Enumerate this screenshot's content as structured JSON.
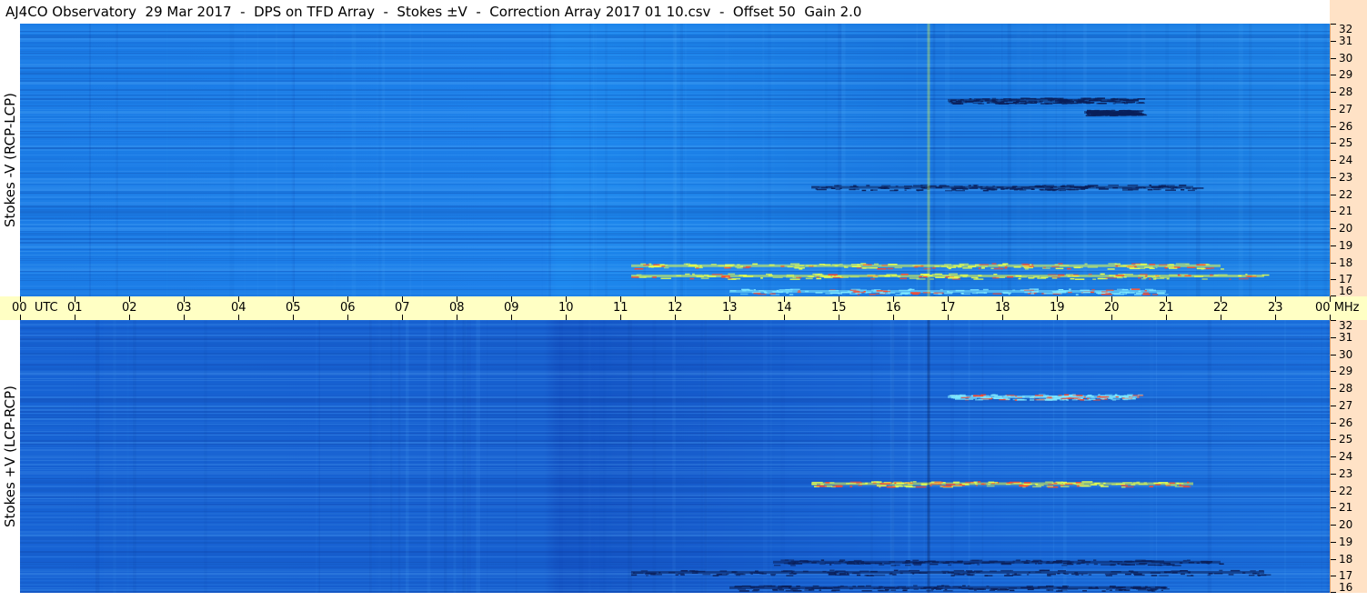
{
  "header": {
    "title": "AJ4CO Observatory  29 Mar 2017  -  DPS on TFD Array  -  Stokes ±V  -  Correction Array 2017 01 10.csv  -  Offset 50  Gain 2.0"
  },
  "chart_data": [
    {
      "type": "heatmap",
      "ylabel": "Stokes -V (RCP-LCP)",
      "xlabel": "UTC",
      "ylim": [
        16,
        32
      ],
      "xlim": [
        0,
        24
      ],
      "x_ticks": [
        "00",
        "01",
        "02",
        "03",
        "04",
        "05",
        "06",
        "07",
        "08",
        "09",
        "10",
        "11",
        "12",
        "13",
        "14",
        "15",
        "16",
        "17",
        "18",
        "19",
        "20",
        "21",
        "22",
        "23",
        "00"
      ],
      "y_ticks": [
        16,
        17,
        18,
        19,
        20,
        21,
        22,
        23,
        24,
        25,
        26,
        27,
        28,
        29,
        30,
        31,
        32
      ],
      "y_unit": "MHz",
      "features": [
        {
          "kind": "bright_band",
          "freq": 17.8,
          "t_start": 11.2,
          "t_end": 22.0,
          "tone": "bright"
        },
        {
          "kind": "bright_band",
          "freq": 17.2,
          "t_start": 11.2,
          "t_end": 22.8,
          "tone": "bright"
        },
        {
          "kind": "bright_band",
          "freq": 16.3,
          "t_start": 13.0,
          "t_end": 21.0,
          "tone": "medium"
        },
        {
          "kind": "dark_band",
          "freq": 22.4,
          "t_start": 14.5,
          "t_end": 21.5,
          "tone": "dark"
        },
        {
          "kind": "dark_band",
          "freq": 27.5,
          "t_start": 17.0,
          "t_end": 20.5,
          "tone": "dark"
        },
        {
          "kind": "dark_band",
          "freq": 26.8,
          "t_start": 19.5,
          "t_end": 20.5,
          "tone": "dark"
        },
        {
          "kind": "vertical_line",
          "t": 16.65,
          "tone": "bright"
        }
      ]
    },
    {
      "type": "heatmap",
      "ylabel": "Stokes +V (LCP-RCP)",
      "xlabel": "UTC",
      "ylim": [
        16,
        32
      ],
      "xlim": [
        0,
        24
      ],
      "x_ticks": [
        "00",
        "01",
        "02",
        "03",
        "04",
        "05",
        "06",
        "07",
        "08",
        "09",
        "10",
        "11",
        "12",
        "13",
        "14",
        "15",
        "16",
        "17",
        "18",
        "19",
        "20",
        "21",
        "22",
        "23",
        "00"
      ],
      "y_ticks": [
        16,
        17,
        18,
        19,
        20,
        21,
        22,
        23,
        24,
        25,
        26,
        27,
        28,
        29,
        30,
        31,
        32
      ],
      "y_unit": "MHz",
      "features": [
        {
          "kind": "dark_band",
          "freq": 17.8,
          "t_start": 13.8,
          "t_end": 22.0,
          "tone": "dark"
        },
        {
          "kind": "dark_band",
          "freq": 17.2,
          "t_start": 11.2,
          "t_end": 22.8,
          "tone": "dark"
        },
        {
          "kind": "dark_band",
          "freq": 16.3,
          "t_start": 13.0,
          "t_end": 21.0,
          "tone": "dark"
        },
        {
          "kind": "bright_band",
          "freq": 22.4,
          "t_start": 14.5,
          "t_end": 21.5,
          "tone": "bright"
        },
        {
          "kind": "bright_band",
          "freq": 27.5,
          "t_start": 17.0,
          "t_end": 20.5,
          "tone": "medium"
        },
        {
          "kind": "vertical_line",
          "t": 16.65,
          "tone": "dark"
        }
      ]
    }
  ],
  "time_axis": {
    "first_label": "00",
    "unit_label": "UTC",
    "last_label": "00",
    "freq_unit": "MHz",
    "labels": [
      "01",
      "02",
      "03",
      "04",
      "05",
      "06",
      "07",
      "08",
      "09",
      "10",
      "11",
      "12",
      "13",
      "14",
      "15",
      "16",
      "17",
      "18",
      "19",
      "20",
      "21",
      "22",
      "23"
    ]
  },
  "colors": {
    "bright": "#e7ff4c",
    "medium": "#7fe9ff",
    "dark": "#0a1f5a",
    "title_bg": "#ffffff",
    "axis_bar": "#ffffc4",
    "freq_bar": "#ffe2c6"
  }
}
